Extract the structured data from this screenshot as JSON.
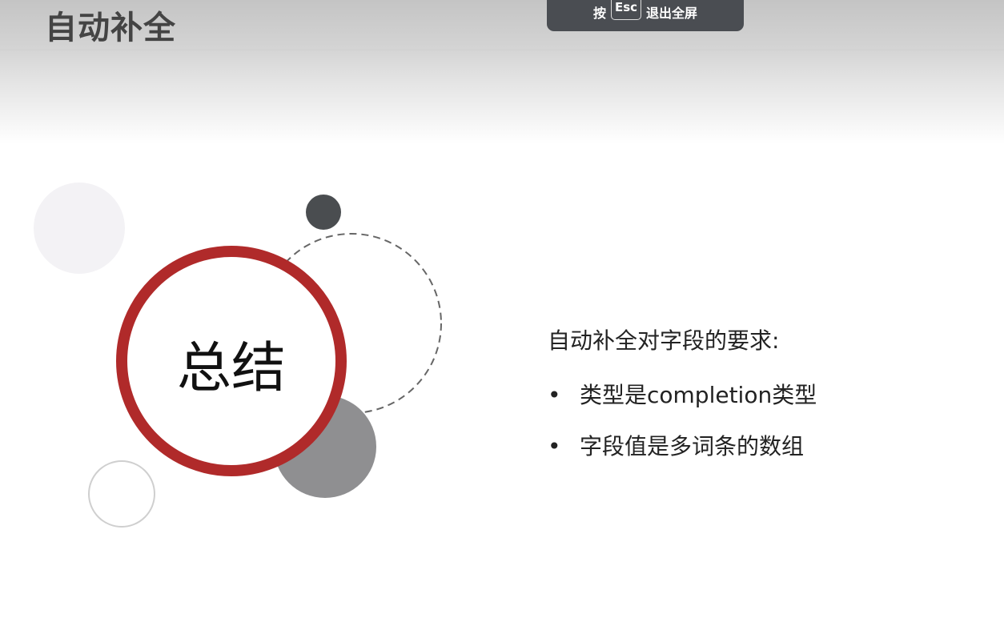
{
  "slide": {
    "title": "自动补全",
    "center_label": "总结",
    "requirement_heading": "自动补全对字段的要求:",
    "bullets": [
      "类型是completion类型",
      "字段值是多词条的数组"
    ]
  },
  "fullscreen_banner": {
    "press": "按",
    "key": "Esc",
    "action": "退出全屏"
  },
  "colors": {
    "accent": "#b02a2a",
    "dark_circle": "#4a4d50",
    "gray_circle": "#8f8f91"
  }
}
